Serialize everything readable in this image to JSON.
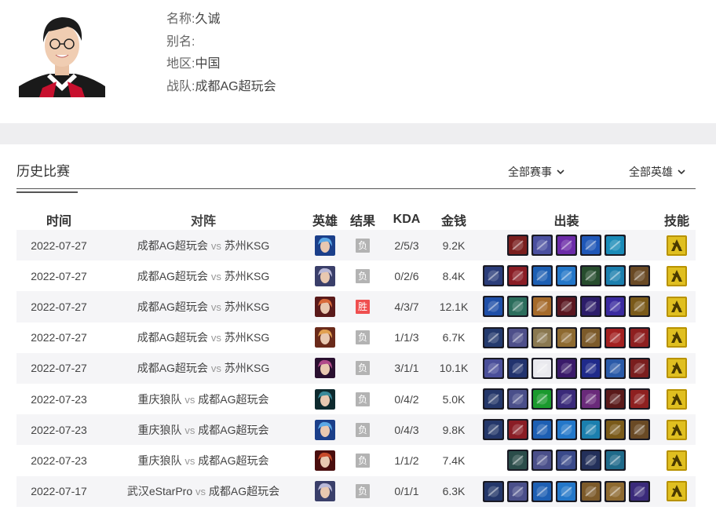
{
  "player": {
    "name_label": "名称:",
    "name_value": "久诚",
    "alias_label": "别名:",
    "alias_value": "",
    "region_label": "地区:",
    "region_value": "中国",
    "team_label": "战队:",
    "team_value": "成都AG超玩会"
  },
  "tabs": {
    "history": "历史比赛",
    "filter_events": "全部赛事",
    "filter_heroes": "全部英雄"
  },
  "columns": [
    "时间",
    "对阵",
    "英雄",
    "结果",
    "KDA",
    "金钱",
    "出装",
    "技能"
  ],
  "vs_label": "vs",
  "colors": {
    "win": "#ef4f4f",
    "lose": "#b3b3b3",
    "row_alt": "#f5f5f7",
    "band": "#eeeef0"
  },
  "matches": [
    {
      "time": "2022-07-27",
      "team_a": "成都AG超玩会",
      "team_b": "苏州KSG",
      "hero": "blue-haired-hero",
      "result": "负",
      "win": false,
      "kda": "2/5/3",
      "gold": "9.2K",
      "items": [
        "#7a1e1e",
        "#4a4fa0",
        "#6b2aa8",
        "#1f57b8",
        "#1a8bb8"
      ]
    },
    {
      "time": "2022-07-27",
      "team_a": "成都AG超玩会",
      "team_b": "苏州KSG",
      "hero": "silver-haired-hero",
      "result": "负",
      "win": false,
      "kda": "0/2/6",
      "gold": "8.4K",
      "items": [
        "#2b3d7a",
        "#8a1d25",
        "#1d5fb3",
        "#2377c9",
        "#274d2e",
        "#1b7fae",
        "#6a4a25"
      ]
    },
    {
      "time": "2022-07-27",
      "team_a": "成都AG超玩会",
      "team_b": "苏州KSG",
      "hero": "red-armored-hero",
      "result": "胜",
      "win": true,
      "kda": "4/3/7",
      "gold": "12.1K",
      "items": [
        "#1f4fa8",
        "#2b6d5c",
        "#a56a2a",
        "#5a1620",
        "#2c1d6a",
        "#3a2aa0",
        "#7a5a1a"
      ]
    },
    {
      "time": "2022-07-27",
      "team_a": "成都AG超玩会",
      "team_b": "苏州KSG",
      "hero": "fox-eared-hero",
      "result": "负",
      "win": false,
      "kda": "1/1/3",
      "gold": "6.7K",
      "items": [
        "#243a6e",
        "#4e4f8a",
        "#8a7850",
        "#8e6a30",
        "#7c5a2a",
        "#a32020",
        "#8e1f1f"
      ]
    },
    {
      "time": "2022-07-27",
      "team_a": "成都AG超玩会",
      "team_b": "苏州KSG",
      "hero": "dark-mage-hero",
      "result": "负",
      "win": false,
      "kda": "3/1/1",
      "gold": "10.1K",
      "items": [
        "#4a4f9a",
        "#22336e",
        "#e9e9ee",
        "#3a1a6a",
        "#1f2a8a",
        "#2a5aa8",
        "#7a1e1e"
      ]
    },
    {
      "time": "2022-07-23",
      "team_a": "重庆狼队",
      "team_b": "成都AG超玩会",
      "hero": "dark-teal-hero",
      "result": "负",
      "win": false,
      "kda": "0/4/2",
      "gold": "5.0K",
      "items": [
        "#24376a",
        "#4a4f8a",
        "#1b9a2e",
        "#3a2a7a",
        "#6a2a7a",
        "#5a1a1a",
        "#8e2020"
      ]
    },
    {
      "time": "2022-07-23",
      "team_a": "重庆狼队",
      "team_b": "成都AG超玩会",
      "hero": "blue-haired-hero",
      "result": "负",
      "win": false,
      "kda": "0/4/3",
      "gold": "9.8K",
      "items": [
        "#24376a",
        "#8a1d25",
        "#1d5fb3",
        "#2377c9",
        "#1b7fae",
        "#7a5a1a",
        "#6a4a25"
      ]
    },
    {
      "time": "2022-07-23",
      "team_a": "重庆狼队",
      "team_b": "成都AG超玩会",
      "hero": "red-swordsman-hero",
      "result": "负",
      "win": false,
      "kda": "1/1/2",
      "gold": "7.4K",
      "items": [
        "#2b4d4a",
        "#4a4f8a",
        "#3a4a8a",
        "#23305a",
        "#1f6a8a"
      ]
    },
    {
      "time": "2022-07-17",
      "team_a": "武汉eStarPro",
      "team_b": "成都AG超玩会",
      "hero": "silver-haired-hero",
      "result": "负",
      "win": false,
      "kda": "0/1/1",
      "gold": "6.3K",
      "items": [
        "#24376a",
        "#4a4f8a",
        "#1d5fb3",
        "#2377c9",
        "#7c5a2a",
        "#8e6a30",
        "#3a2a7a"
      ]
    }
  ]
}
